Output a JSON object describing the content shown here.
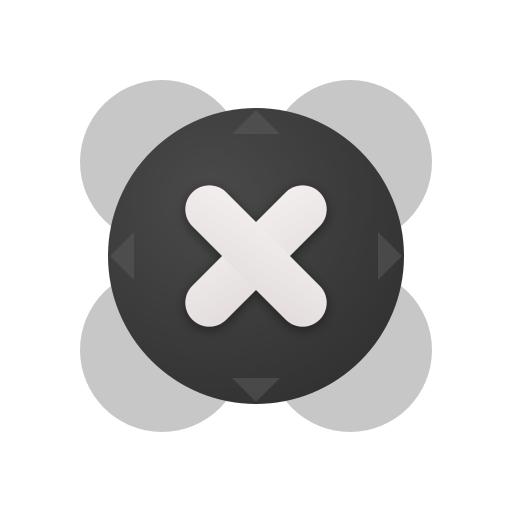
{
  "icon": {
    "name": "close-icon",
    "colors": {
      "background": "#ffffff",
      "petal": "#bdbdbd",
      "disc_light": "#4a4a4a",
      "disc_dark": "#2f2f2f",
      "cross_light": "#f4efef",
      "cross_dark": "#e2dcdc"
    }
  }
}
